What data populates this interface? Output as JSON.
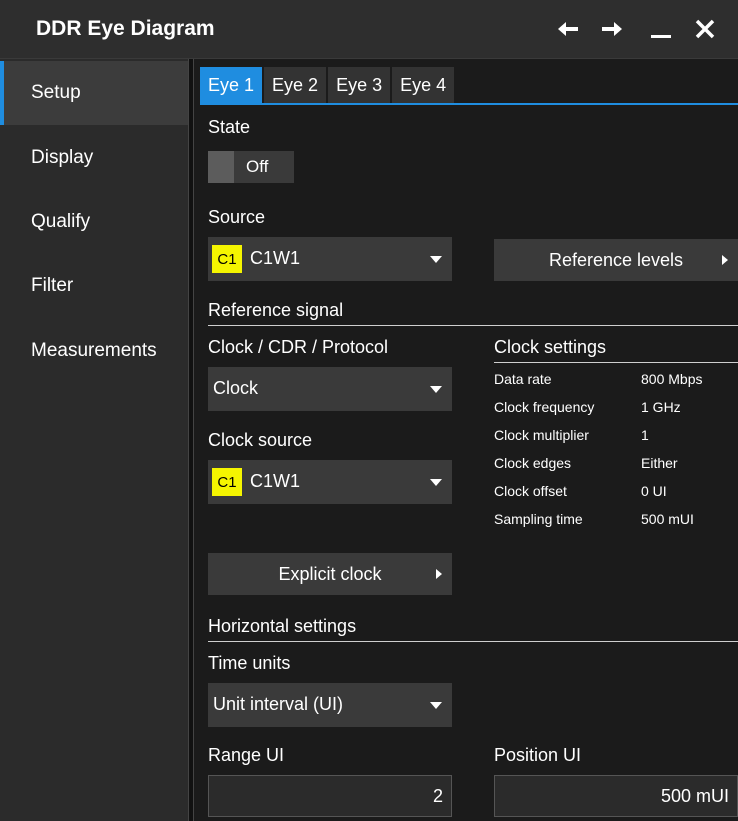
{
  "window": {
    "title": "DDR Eye Diagram",
    "buttons": [
      "back-arrow-icon",
      "forward-arrow-icon",
      "minimize-icon",
      "close-icon"
    ]
  },
  "sidebar": {
    "items": [
      {
        "label": "Setup",
        "active": true
      },
      {
        "label": "Display"
      },
      {
        "label": "Qualify"
      },
      {
        "label": "Filter"
      },
      {
        "label": "Measurements"
      }
    ]
  },
  "tabs": [
    {
      "label": "Eye 1",
      "active": true
    },
    {
      "label": "Eye 2"
    },
    {
      "label": "Eye 3"
    },
    {
      "label": "Eye 4"
    }
  ],
  "state": {
    "label": "State",
    "value": "Off"
  },
  "source": {
    "label": "Source",
    "chip": "C1",
    "value": "C1W1"
  },
  "reference_levels": {
    "label": "Reference levels"
  },
  "reference_signal": {
    "heading": "Reference signal",
    "mode_label": "Clock / CDR / Protocol",
    "mode_value": "Clock",
    "clock_source_label": "Clock source",
    "clock_source_chip": "C1",
    "clock_source_value": "C1W1",
    "explicit_clock": "Explicit clock"
  },
  "clock_settings": {
    "heading": "Clock settings",
    "rows": [
      {
        "key": "Data rate",
        "value": "800 Mbps"
      },
      {
        "key": "Clock frequency",
        "value": "1 GHz"
      },
      {
        "key": "Clock multiplier",
        "value": "1"
      },
      {
        "key": "Clock edges",
        "value": "Either"
      },
      {
        "key": "Clock offset",
        "value": "0 UI"
      },
      {
        "key": "Sampling time",
        "value": "500 mUI"
      }
    ]
  },
  "horizontal": {
    "heading": "Horizontal settings",
    "time_units_label": "Time units",
    "time_units_value": "Unit interval (UI)",
    "range_label": "Range UI",
    "range_value": "2",
    "position_label": "Position UI",
    "position_value": "500 mUI"
  },
  "colors": {
    "accent": "#1f8de0",
    "chip": "#f5f500",
    "panel": "#1b1b1b"
  }
}
